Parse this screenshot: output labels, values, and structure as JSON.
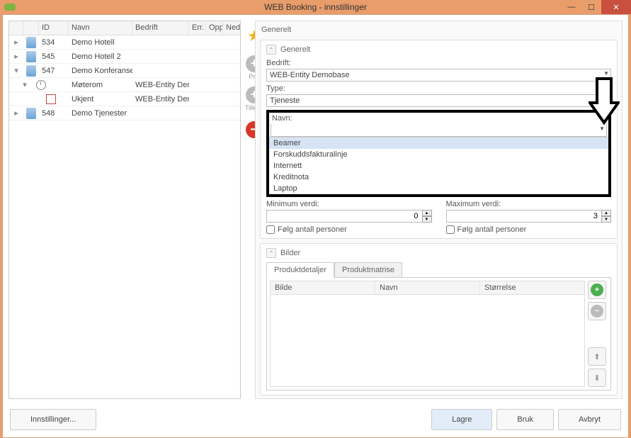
{
  "window": {
    "title": "WEB Booking - innstillinger"
  },
  "tree": {
    "headers": {
      "id": "ID",
      "navn": "Navn",
      "bedrift": "Bedrift",
      "err": "Err.",
      "opp": "Opp",
      "ned": "Ned"
    },
    "rows": [
      {
        "expand": "▸",
        "icon": "doc",
        "id": "534",
        "navn": "Demo Hotell",
        "bedrift": "",
        "indent": 0
      },
      {
        "expand": "▸",
        "icon": "doc",
        "id": "545",
        "navn": "Demo Hotell 2",
        "bedrift": "",
        "indent": 0
      },
      {
        "expand": "▾",
        "icon": "doc",
        "id": "547",
        "navn": "Demo Konferansesenter",
        "bedrift": "",
        "indent": 0
      },
      {
        "expand": "▾",
        "icon": "clock",
        "id": "",
        "navn": "Møterom",
        "bedrift": "WEB-Entity Demobase",
        "indent": 1
      },
      {
        "expand": "",
        "icon": "unknown",
        "id": "",
        "navn": "Ukjent",
        "bedrift": "WEB-Entity Demobase",
        "indent": 2
      },
      {
        "expand": "▸",
        "icon": "doc",
        "id": "548",
        "navn": "Demo Tjenester",
        "bedrift": "",
        "indent": 0
      }
    ]
  },
  "sideButtons": {
    "pris": "Pris",
    "tillegg": "Tillegg"
  },
  "generelt": {
    "paneTitle": "Generelt",
    "sectionTitle": "Generelt",
    "bedriftLabel": "Bedrift:",
    "bedriftValue": "WEB-Entity Demobase",
    "typeLabel": "Type:",
    "typeValue": "Tjeneste",
    "navnLabel": "Navn:",
    "navnValue": "",
    "dropdownOptions": [
      "Beamer",
      "Forskuddsfakturalinje",
      "Internett",
      "Kreditnota",
      "Laptop"
    ],
    "minLabel": "Minimum verdi:",
    "minValue": "0",
    "maxLabel": "Maximum verdi:",
    "maxValue": "3",
    "followPersons": "Følg antall personer"
  },
  "bilder": {
    "sectionTitle": "Bilder",
    "tabs": {
      "detaljer": "Produktdetaljer",
      "matrise": "Produktmatrise"
    },
    "headers": {
      "bilde": "Bilde",
      "navn": "Navn",
      "storrelse": "Størrelse"
    }
  },
  "footer": {
    "settings": "Innstillinger...",
    "save": "Lagre",
    "use": "Bruk",
    "cancel": "Avbryt"
  }
}
